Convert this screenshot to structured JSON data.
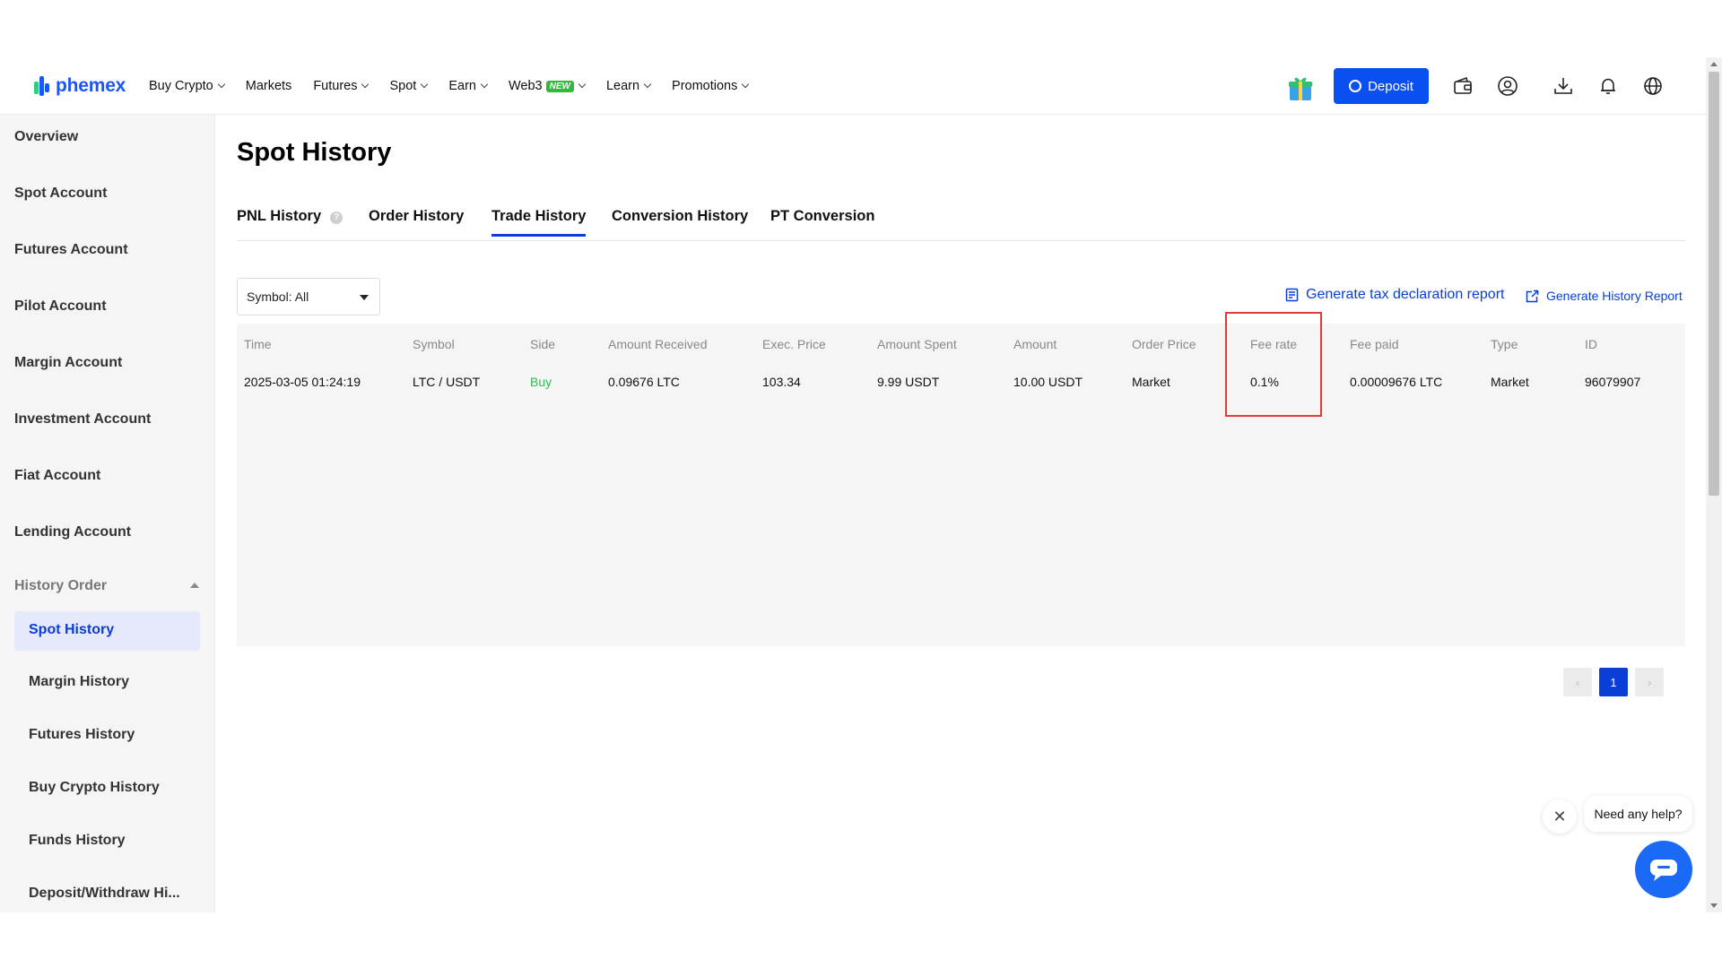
{
  "brand": {
    "name": "phemex",
    "color": "#1a56ff"
  },
  "nav": [
    {
      "label": "Buy Crypto",
      "dropdown": true
    },
    {
      "label": "Markets",
      "dropdown": false
    },
    {
      "label": "Futures",
      "dropdown": true
    },
    {
      "label": "Spot",
      "dropdown": true
    },
    {
      "label": "Earn",
      "dropdown": true
    },
    {
      "label": "Web3",
      "dropdown": true,
      "badge": "NEW"
    },
    {
      "label": "Learn",
      "dropdown": true
    },
    {
      "label": "Promotions",
      "dropdown": true
    }
  ],
  "header": {
    "deposit_label": "Deposit",
    "icons": [
      "gift-icon",
      "wallet-icon",
      "user-icon",
      "download-icon",
      "bell-icon",
      "globe-icon"
    ]
  },
  "sidebar": {
    "items": [
      "Overview",
      "Spot Account",
      "Futures Account",
      "Pilot Account",
      "Margin Account",
      "Investment Account",
      "Fiat Account",
      "Lending Account"
    ],
    "group_label": "History Order",
    "sub_items": [
      "Spot History",
      "Margin History",
      "Futures History",
      "Buy Crypto History",
      "Funds History",
      "Deposit/Withdraw Hi..."
    ],
    "active": "Spot History"
  },
  "page": {
    "title": "Spot History",
    "tabs": [
      "PNL History",
      "Order History",
      "Trade History",
      "Conversion History",
      "PT Conversion"
    ],
    "active_tab": "Trade History"
  },
  "filters": {
    "symbol_label": "Symbol: All"
  },
  "links": {
    "tax_report": "Generate tax declaration report",
    "history_report": "Generate History Report"
  },
  "table": {
    "columns": [
      "Time",
      "Symbol",
      "Side",
      "Amount Received",
      "Exec. Price",
      "Amount Spent",
      "Amount",
      "Order Price",
      "Fee rate",
      "Fee paid",
      "Type",
      "ID"
    ],
    "rows": [
      [
        "2025-03-05 01:24:19",
        "LTC / USDT",
        "Buy",
        "0.09676 LTC",
        "103.34",
        "9.99 USDT",
        "10.00 USDT",
        "Market",
        "0.1%",
        "0.00009676 LTC",
        "Market",
        "96079907"
      ]
    ]
  },
  "pagination": {
    "current": "1"
  },
  "help": {
    "bubble": "Need any help?"
  },
  "colors": {
    "accent": "#0a3fd6",
    "buy": "#2dbb55",
    "highlight": "#e23a3a",
    "deposit": "#0a4ff0"
  }
}
